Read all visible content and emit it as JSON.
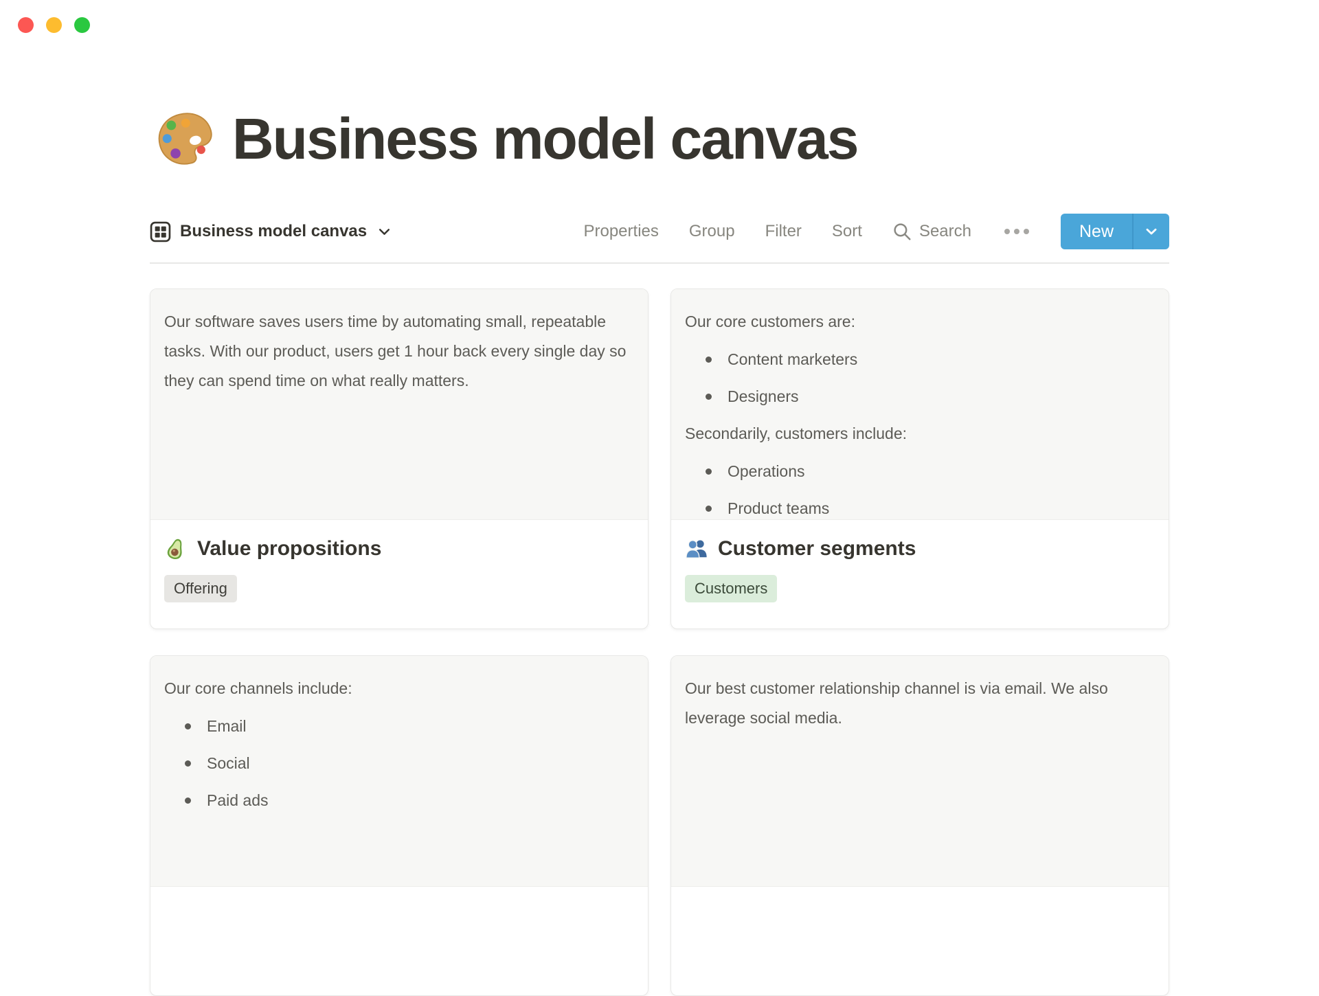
{
  "window": {
    "controls": [
      {
        "name": "close",
        "color": "#fc5753"
      },
      {
        "name": "minimize",
        "color": "#fdbc2f"
      },
      {
        "name": "zoom",
        "color": "#2ac840"
      }
    ]
  },
  "page": {
    "icon": "palette-icon",
    "title": "Business model canvas"
  },
  "toolbar": {
    "view_switcher": {
      "icon": "gallery-view-icon",
      "label": "Business model canvas",
      "chevron": "chevron-down-icon"
    },
    "menu_items": [
      {
        "label": "Properties"
      },
      {
        "label": "Group"
      },
      {
        "label": "Filter"
      },
      {
        "label": "Sort"
      }
    ],
    "search": {
      "icon": "search-icon",
      "label": "Search"
    },
    "more": {
      "icon": "ellipsis-icon"
    },
    "new_button": {
      "label": "New",
      "color": "#4aa6d9",
      "chevron": "chevron-down-icon"
    }
  },
  "gallery": {
    "cards": [
      {
        "preview_blocks": [
          {
            "type": "p",
            "text": "Our software saves users time by automating small, repeatable tasks. With our product, users get 1 hour back every single day so they can spend time on what really matters."
          }
        ],
        "icon": "avocado-icon",
        "title": "Value propositions",
        "tags": [
          {
            "label": "Offering",
            "bg": "#e7e6e3",
            "text_color": "#3f3e39"
          }
        ]
      },
      {
        "preview_blocks": [
          {
            "type": "p",
            "text": "Our core customers are:"
          },
          {
            "type": "li",
            "text": "Content marketers"
          },
          {
            "type": "li",
            "text": "Designers"
          },
          {
            "type": "p",
            "text": "Secondarily, customers include:"
          },
          {
            "type": "li",
            "text": "Operations"
          },
          {
            "type": "li",
            "text": "Product teams"
          }
        ],
        "icon": "people-icon",
        "title": "Customer segments",
        "tags": [
          {
            "label": "Customers",
            "bg": "#dbeddb",
            "text_color": "#3b4a39"
          }
        ]
      },
      {
        "preview_blocks": [
          {
            "type": "p",
            "text": "Our core channels include:"
          },
          {
            "type": "li",
            "text": "Email"
          },
          {
            "type": "li",
            "text": "Social"
          },
          {
            "type": "li",
            "text": "Paid ads"
          }
        ]
      },
      {
        "preview_blocks": [
          {
            "type": "p",
            "text": "Our best customer relationship channel is via email. We also leverage social media."
          }
        ]
      }
    ]
  }
}
